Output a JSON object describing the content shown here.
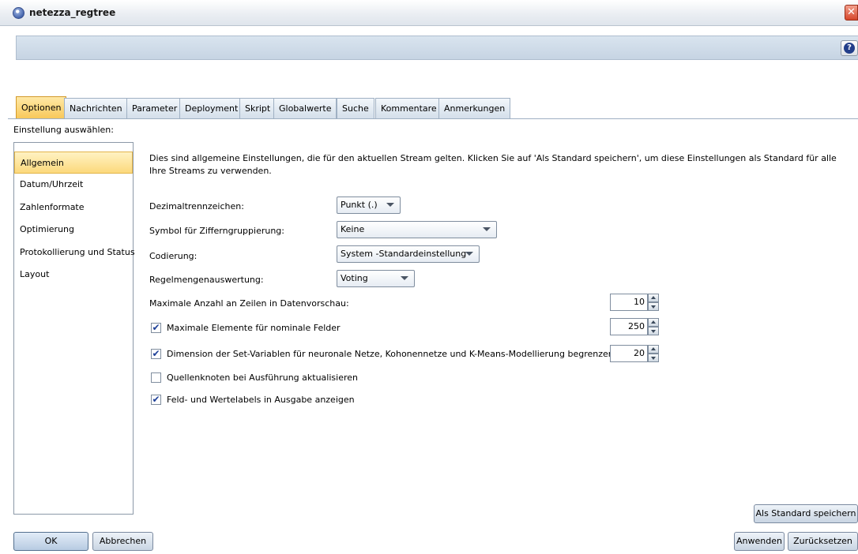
{
  "window": {
    "title": "netezza_regtree",
    "close_glyph": "✕",
    "help_glyph": "?"
  },
  "tabs": [
    {
      "label": "Optionen",
      "active": true
    },
    {
      "label": "Nachrichten"
    },
    {
      "label": "Parameter"
    },
    {
      "label": "Deployment"
    },
    {
      "label": "Skript"
    },
    {
      "label": "Globalwerte"
    },
    {
      "label": "Suche"
    },
    {
      "label": "Kommentare"
    },
    {
      "label": "Anmerkungen"
    }
  ],
  "section_label": "Einstellung auswählen:",
  "nav": [
    {
      "label": "Allgemein",
      "selected": true
    },
    {
      "label": "Datum/Uhrzeit"
    },
    {
      "label": "Zahlenformate"
    },
    {
      "label": "Optimierung"
    },
    {
      "label": "Protokollierung und Status"
    },
    {
      "label": "Layout"
    }
  ],
  "description": "Dies sind allgemeine Einstellungen, die für den aktuellen Stream gelten. Klicken Sie auf 'Als Standard speichern', um diese Einstellungen als Standard für alle Ihre Streams zu verwenden.",
  "fields": {
    "dezimal": {
      "label": "Dezimaltrennzeichen:",
      "value": "Punkt (.)"
    },
    "gruppierung": {
      "label": "Symbol für Zifferngruppierung:",
      "value": "Keine"
    },
    "codierung": {
      "label": "Codierung:",
      "value": "System -Standardeinstellung"
    },
    "regelmengen": {
      "label": "Regelmengenauswertung:",
      "value": "Voting"
    },
    "max_zeilen": {
      "label": "Maximale Anzahl an Zeilen in Datenvorschau:",
      "value": "10"
    }
  },
  "checkboxes": {
    "max_elemente": {
      "label": "Maximale Elemente für nominale Felder",
      "checked": true,
      "value": "250"
    },
    "dimension": {
      "label": "Dimension der Set-Variablen für neuronale Netze, Kohonennetze und K-Means-Modellierung begrenzen",
      "checked": true,
      "value": "20"
    },
    "quellenknoten": {
      "label": "Quellenknoten bei Ausführung aktualisieren",
      "checked": false
    },
    "labels": {
      "label": "Feld- und Wertelabels in Ausgabe anzeigen",
      "checked": true
    }
  },
  "check_glyph": "✔",
  "buttons": {
    "save_default": "Als Standard speichern",
    "ok": "OK",
    "cancel": "Abbrechen",
    "apply": "Anwenden",
    "reset": "Zurücksetzen"
  }
}
